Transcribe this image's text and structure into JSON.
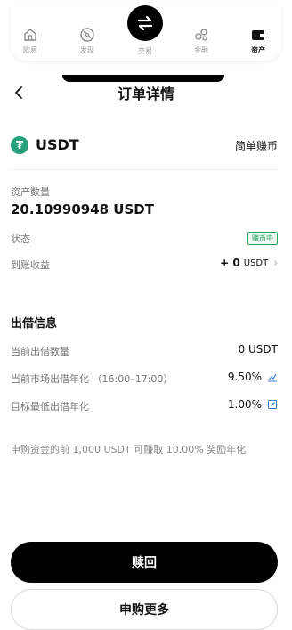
{
  "tabbar": {
    "tabs": [
      {
        "label": "欧易",
        "icon": "home-icon"
      },
      {
        "label": "发现",
        "icon": "discover-icon"
      },
      {
        "label": "交易",
        "icon": "trade-swap-icon"
      },
      {
        "label": "金融",
        "icon": "finance-icon"
      },
      {
        "label": "资产",
        "icon": "wallet-icon"
      }
    ],
    "active": "资产"
  },
  "header": {
    "title": "订单详情",
    "back_icon": "back-arrow-icon"
  },
  "asset": {
    "coin_icon_glyph": "₮",
    "coin": "USDT",
    "product_type": "简单赚币",
    "amount_label": "资产数量",
    "amount_value": "20.10990948 USDT",
    "status_label": "状态",
    "status_badge": "赚币中",
    "earnings_label": "到账收益",
    "earnings_value": "+ 0",
    "earnings_unit": "USDT"
  },
  "lending": {
    "section_title": "出借信息",
    "rows": [
      {
        "label": "当前出借数量",
        "value": "0 USDT",
        "icon": ""
      },
      {
        "label": "当前市场出借年化 （16:00–17:00）",
        "value": "9.50%",
        "icon": "trend-chart-icon"
      },
      {
        "label": "目标最低出借年化",
        "value": "1.00%",
        "icon": "edit-icon"
      }
    ]
  },
  "note": "申购资金的前 1,000 USDT 可赚取 10.00% 奖励年化",
  "buttons": {
    "redeem": "赎回",
    "subscribe_more": "申购更多"
  },
  "colors": {
    "accent": "#000000",
    "status_green": "#2aa35d",
    "usdt_green": "#26a17b"
  }
}
